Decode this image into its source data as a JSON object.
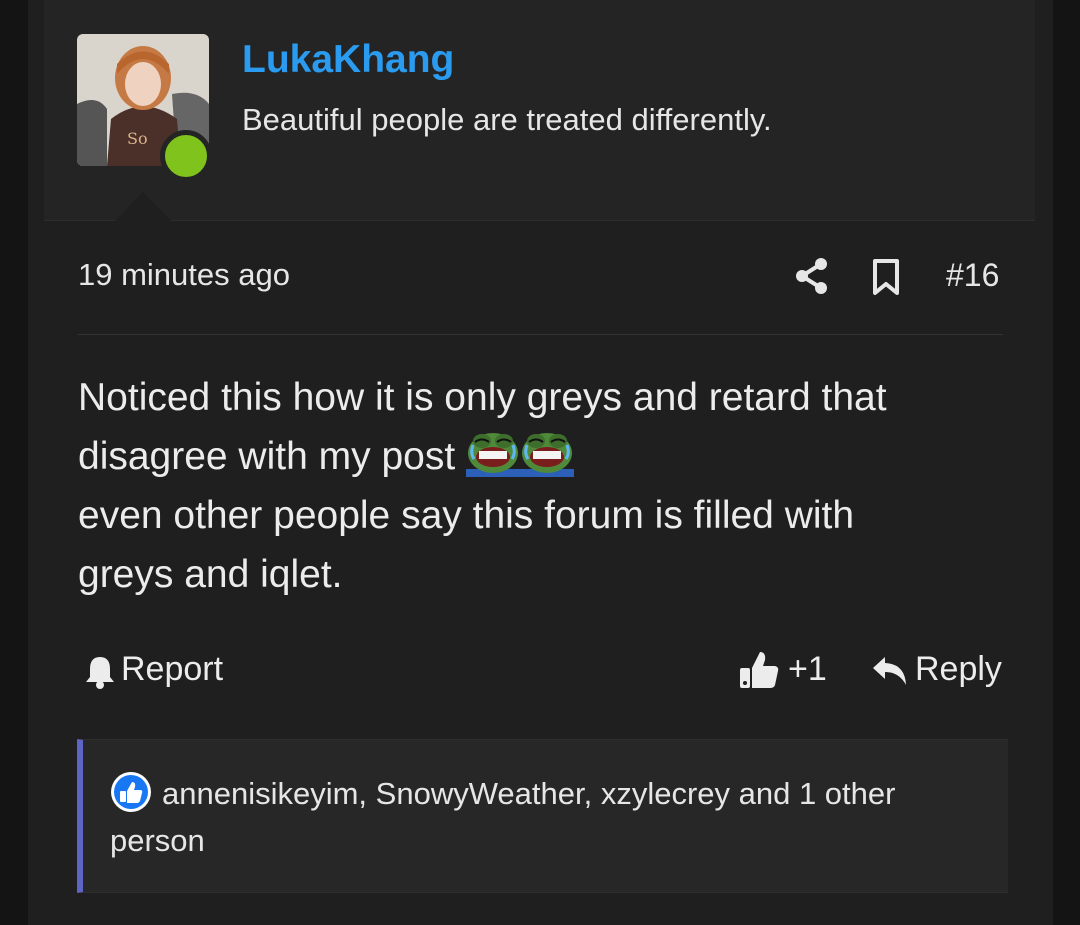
{
  "post": {
    "username": "LukaKhang",
    "user_title": "Beautiful people are treated differently.",
    "timestamp": "19 minutes ago",
    "post_number": "#16",
    "message_line1": "Noticed this how it is only greys and retard that",
    "message_line2": "disagree with my post",
    "message_line3": "even other people say this forum is filled with",
    "message_line4": "greys and iqlet.",
    "emoji_name": "laughing-crying-frog-emoji"
  },
  "actions": {
    "report_label": "Report",
    "like_count": "+1",
    "reply_label": "Reply"
  },
  "reactions": {
    "text": "annenisikeyim, SnowyWeather, xzylecrey and 1 other person"
  },
  "colors": {
    "username": "#2b9bf0",
    "online": "#7fc31c",
    "accent_bar": "#5d66c4",
    "like_badge": "#1877f2"
  }
}
